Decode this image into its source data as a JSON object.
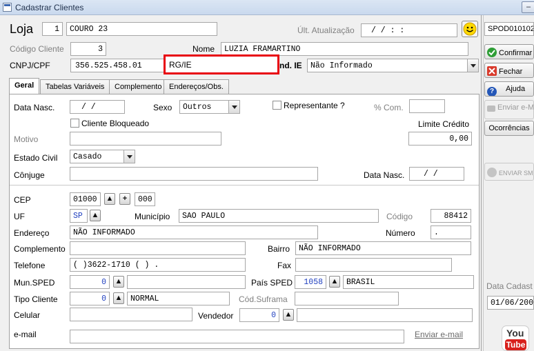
{
  "window": {
    "title": "Cadastrar Clientes"
  },
  "header": {
    "loja_label": "Loja",
    "loja_num": "1",
    "loja_name": "COURO 23",
    "ult_atual_label": "Últ. Atualização",
    "ult_atual_value": "/   /       :   :",
    "codigo_label": "Código Cliente",
    "codigo_value": "3",
    "nome_label": "Nome",
    "nome_value": "LUZIA FRAMARTINO",
    "cnpj_label": "CNPJ/CPF",
    "cnpj_value": "356.525.458.01",
    "rgie_label": "RG/IE",
    "rgie_value": "",
    "ind_ie_label": "nd. IE",
    "ind_ie_value": "Não Informado"
  },
  "tabs": [
    {
      "label": "Geral"
    },
    {
      "label": "Tabelas Variáveis"
    },
    {
      "label": "Complemento"
    },
    {
      "label": "Endereços/Obs."
    }
  ],
  "geral": {
    "data_nasc_label": "Data Nasc.",
    "data_nasc_value": "/   /",
    "sexo_label": "Sexo",
    "sexo_value": "Outros",
    "representante_label": "Representante ?",
    "pct_com_label": "% Com.",
    "pct_com_value": "",
    "cliente_bloqueado_label": "Cliente Bloqueado",
    "limite_credito_label": "Limite Crédito",
    "limite_credito_value": "0,00",
    "motivo_label": "Motivo",
    "motivo_value": "",
    "estado_civil_label": "Estado Civil",
    "estado_civil_value": "Casado",
    "conjuge_label": "Cônjuge",
    "conjuge_value": "",
    "conj_data_nasc_label": "Data Nasc.",
    "conj_data_nasc_value": "/   /",
    "cep_label": "CEP",
    "cep_value": "01000",
    "cep_suffix": "000",
    "uf_label": "UF",
    "uf_value": "SP",
    "municipio_label": "Município",
    "municipio_value": "SAO PAULO",
    "codigo_label": "Código",
    "codigo_value": "88412",
    "endereco_label": "Endereço",
    "endereco_value": "NÃO INFORMADO",
    "numero_label": "Número",
    "numero_value": ".",
    "complemento_label": "Complemento",
    "complemento_value": "",
    "bairro_label": "Bairro",
    "bairro_value": "NÃO INFORMADO",
    "telefone_label": "Telefone",
    "telefone_value": "(    )3622-1710 (    )    .",
    "fax_label": "Fax",
    "fax_value": "",
    "mun_sped_label": "Mun.SPED",
    "mun_sped_value": "0",
    "mun_sped_name": "",
    "pais_sped_label": "País SPED",
    "pais_sped_value": "1058",
    "pais_sped_name": "BRASIL",
    "tipo_cliente_label": "Tipo Cliente",
    "tipo_cliente_value": "0",
    "tipo_cliente_name": "NORMAL",
    "cod_suframa_label": "Cód.Suframa",
    "cod_suframa_value": "",
    "celular_label": "Celular",
    "celular_value": "",
    "vendedor_label": "Vendedor",
    "vendedor_value": "0",
    "vendedor_name": "",
    "email_label": "e-mail",
    "email_value": "",
    "enviar_email_link": "Enviar e-mail"
  },
  "sidebar": {
    "code": "SPOD010102",
    "confirmar": "Confirmar",
    "fechar": "Fechar",
    "ajuda": "Ajuda",
    "enviar_email": "Enviar e-M",
    "ocorrencias": "Ocorrências",
    "enviar_sms": "ENVIAR SM",
    "data_cadastro_label": "Data Cadast",
    "data_cadastro_value": "01/06/200",
    "youtube_top": "You",
    "youtube_bottom": "Tube"
  },
  "colors": {
    "highlight_box": "#e8000e",
    "youtube_red": "#d8201c",
    "field_blue": "#1f3fbf"
  }
}
